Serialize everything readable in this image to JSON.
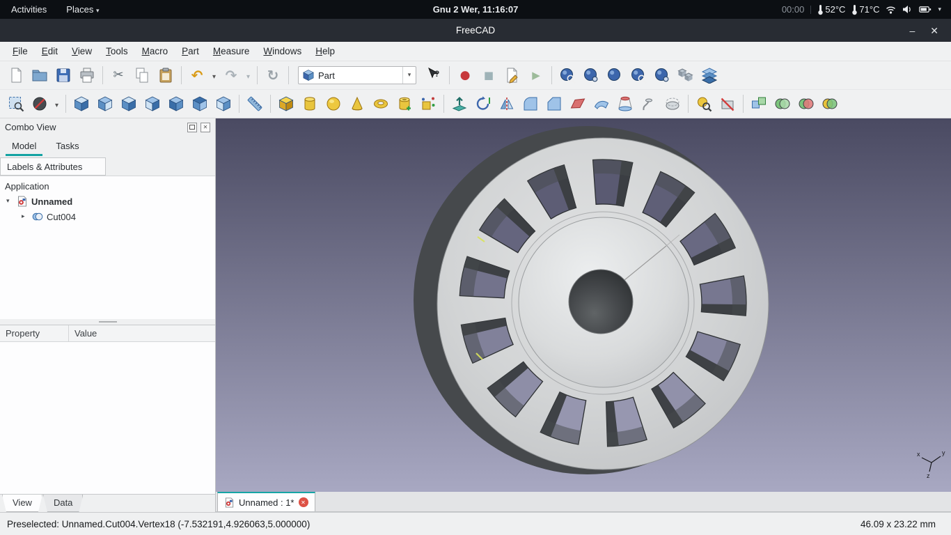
{
  "colors": {
    "accent": "#14a3a3",
    "record_red": "#c7393c",
    "viewport_top": "#4a4a62",
    "viewport_bottom": "#a8a8c2",
    "part_face": "#d2d4d5",
    "part_side": "#46494c"
  },
  "topbar": {
    "activities": "Activities",
    "places": "Places",
    "clock": "Gnu 2 Wer, 11:16:07",
    "timer": "00:00",
    "temp_cpu": "52°C",
    "temp_gpu": "71°C"
  },
  "titlebar": {
    "title": "FreeCAD",
    "minimize": "–",
    "close": "✕"
  },
  "menubar": {
    "items": [
      "File",
      "Edit",
      "View",
      "Tools",
      "Macro",
      "Part",
      "Measure",
      "Windows",
      "Help"
    ]
  },
  "toolbars": {
    "row1": {
      "file": [
        {
          "n": "new-file-icon",
          "t": "page"
        },
        {
          "n": "open-file-icon",
          "t": "folder"
        },
        {
          "n": "save-icon",
          "t": "floppy"
        },
        {
          "n": "print-icon",
          "t": "printer"
        }
      ],
      "edit": [
        {
          "n": "cut-icon",
          "t": "glyph",
          "g": "✂",
          "c": "#5f6b73",
          "s": 18
        },
        {
          "n": "copy-icon",
          "t": "copy"
        },
        {
          "n": "paste-icon",
          "t": "paste"
        }
      ],
      "undo": [
        {
          "n": "undo-icon",
          "t": "glyph",
          "g": "↶",
          "c": "#d99b17",
          "s": 20,
          "b": 1
        },
        {
          "n": "undo-dropdown-icon",
          "t": "glyph",
          "g": "▾",
          "c": "#555",
          "s": 10,
          "narrow": 1
        },
        {
          "n": "redo-icon",
          "t": "glyph",
          "g": "↷",
          "c": "#aab2b8",
          "s": 20,
          "b": 1
        },
        {
          "n": "redo-dropdown-icon",
          "t": "glyph",
          "g": "▾",
          "c": "#aab2b8",
          "s": 10,
          "narrow": 1
        }
      ],
      "refresh": [
        {
          "n": "refresh-icon",
          "t": "glyph",
          "g": "↻",
          "c": "#9aa2a8",
          "s": 20,
          "b": 1
        }
      ],
      "workbench": {
        "label": "Part"
      },
      "help": [
        {
          "n": "whats-this-icon",
          "t": "helpcursor"
        }
      ],
      "macro": [
        {
          "n": "macro-record-icon",
          "t": "glyph",
          "g": "●",
          "c": "#c7393c",
          "s": 17
        },
        {
          "n": "macro-stop-icon",
          "t": "glyph",
          "g": "■",
          "c": "#9fb3b8",
          "s": 15
        },
        {
          "n": "macro-edit-icon",
          "t": "edit"
        },
        {
          "n": "macro-play-icon",
          "t": "glyph",
          "g": "▶",
          "c": "#9dbb9a",
          "s": 15
        }
      ],
      "view": [
        {
          "n": "fit-all-icon",
          "t": "sphere",
          "o": "mag"
        },
        {
          "n": "fit-selection-icon",
          "t": "sphere",
          "o": "dot"
        },
        {
          "n": "align-view-icon",
          "t": "sphere"
        },
        {
          "n": "zoom-view-icon",
          "t": "sphere",
          "o": "mag"
        },
        {
          "n": "perspective-view-icon",
          "t": "sphere",
          "o": "dot"
        },
        {
          "n": "link-make-icon",
          "t": "cubes2"
        },
        {
          "n": "appearance-icon",
          "t": "layers"
        }
      ]
    },
    "row2": {
      "select": [
        {
          "n": "box-selection-icon",
          "t": "boxsel"
        },
        {
          "n": "draw-style-icon",
          "t": "slashcircle"
        },
        {
          "n": "draw-style-dropdown-icon",
          "t": "glyph",
          "g": "▾",
          "c": "#555",
          "s": 10,
          "narrow": 1
        }
      ],
      "stdviews": [
        {
          "n": "view-isometric-icon",
          "t": "cube",
          "f": [
            "#cfe3f4",
            "#5b8fc4",
            "#3a6ea8"
          ]
        },
        {
          "n": "view-front-icon",
          "t": "cube",
          "f": [
            "#9fc3e8",
            "#5b8fc4",
            "#cfe3f4"
          ]
        },
        {
          "n": "view-top-icon",
          "t": "cube",
          "f": [
            "#cfe3f4",
            "#5b8fc4",
            "#3a6ea8"
          ]
        },
        {
          "n": "view-right-icon",
          "t": "cube",
          "f": [
            "#9fc3e8",
            "#cfe3f4",
            "#3a6ea8"
          ]
        },
        {
          "n": "view-rear-icon",
          "t": "cube",
          "f": [
            "#9fc3e8",
            "#3a6ea8",
            "#5b8fc4"
          ]
        },
        {
          "n": "view-bottom-icon",
          "t": "cube",
          "f": [
            "#3a6ea8",
            "#5b8fc4",
            "#9fc3e8"
          ]
        },
        {
          "n": "view-left-icon",
          "t": "cube",
          "f": [
            "#9fc3e8",
            "#cfe3f4",
            "#5b8fc4"
          ]
        }
      ],
      "measure": [
        {
          "n": "measure-distance-icon",
          "t": "ruler"
        }
      ],
      "primitives": [
        {
          "n": "part-box-icon",
          "t": "cube",
          "f": [
            "#f6d54d",
            "#dca826",
            "#c08a10"
          ]
        },
        {
          "n": "part-cylinder-icon",
          "t": "cylinder"
        },
        {
          "n": "part-sphere-icon",
          "t": "psphere"
        },
        {
          "n": "part-cone-icon",
          "t": "cone"
        },
        {
          "n": "part-torus-icon",
          "t": "torus"
        },
        {
          "n": "part-primitives-icon",
          "t": "tube"
        },
        {
          "n": "shape-builder-icon",
          "t": "shapebuilder"
        }
      ],
      "modify": [
        {
          "n": "extrude-icon",
          "t": "extrude"
        },
        {
          "n": "revolve-icon",
          "t": "revolve"
        },
        {
          "n": "mirror-icon",
          "t": "mirror"
        },
        {
          "n": "fillet-icon",
          "t": "fillet"
        },
        {
          "n": "chamfer-icon",
          "t": "chamfer"
        },
        {
          "n": "make-face-icon",
          "t": "makeface"
        },
        {
          "n": "ruled-surface-icon",
          "t": "ruledsurf"
        },
        {
          "n": "loft-icon",
          "t": "loft"
        },
        {
          "n": "sweep-icon",
          "t": "sweep"
        },
        {
          "n": "offset-icon",
          "t": "offsetsh"
        }
      ],
      "analyze": [
        {
          "n": "check-geometry-icon",
          "t": "checkgeo"
        },
        {
          "n": "defeaturing-icon",
          "t": "defeat"
        }
      ],
      "boolean": [
        {
          "n": "compound-icon",
          "t": "compound"
        },
        {
          "n": "boolean-union-icon",
          "t": "boolpair",
          "c1": "#7cc47c",
          "c2": "#a8d8a8"
        },
        {
          "n": "boolean-cut-icon",
          "t": "boolpair",
          "c1": "#7cc47c",
          "c2": "#e07a7a"
        },
        {
          "n": "boolean-common-icon",
          "t": "boolpair",
          "c1": "#e8c23a",
          "c2": "#7cc47c"
        }
      ]
    }
  },
  "combo_view": {
    "title": "Combo View",
    "tabs": [
      {
        "label": "Model",
        "active": true
      },
      {
        "label": "Tasks",
        "active": false
      }
    ],
    "labels_header": "Labels & Attributes",
    "tree": {
      "root": "Application",
      "document": "Unnamed",
      "item": "Cut004"
    },
    "property_table": {
      "columns": [
        "Property",
        "Value"
      ]
    },
    "bottom_tabs": [
      {
        "label": "View",
        "active": true
      },
      {
        "label": "Data",
        "active": false
      }
    ]
  },
  "viewport": {
    "mdi_tab": "Unnamed : 1*"
  },
  "statusbar": {
    "message": "Preselected: Unnamed.Cut004.Vertex18 (-7.532191,4.926063,5.000000)",
    "dimensions": "46.09 x 23.22 mm"
  }
}
